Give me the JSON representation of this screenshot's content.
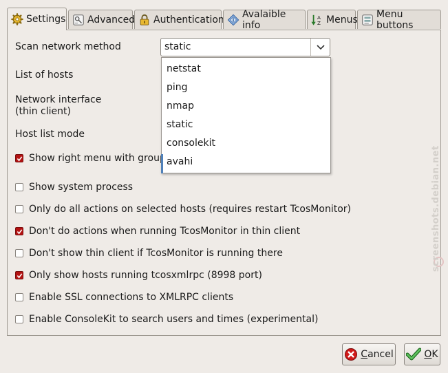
{
  "tabs": [
    {
      "label": "Settings",
      "icon": "gear-icon"
    },
    {
      "label": "Advanced",
      "icon": "advanced-icon"
    },
    {
      "label": "Authentication",
      "icon": "lock-icon"
    },
    {
      "label": "Avalaible info",
      "icon": "info-diamond-icon"
    },
    {
      "label": "Menus",
      "icon": "sort-icon"
    },
    {
      "label": "Menu buttons",
      "icon": "menu-buttons-icon"
    }
  ],
  "form": {
    "scan_method_label": "Scan network method",
    "scan_method_value": "static",
    "hosts_label": "List of hosts",
    "interface_label_1": "Network interface",
    "interface_label_2": "(thin client)",
    "host_mode_label": "Host list mode"
  },
  "dropdown_options": [
    "netstat",
    "ping",
    "nmap",
    "static",
    "consolekit",
    "avahi"
  ],
  "checkboxes": [
    {
      "label": "Show right menu with groups",
      "checked": true
    },
    {
      "label": "Show system process",
      "checked": false
    },
    {
      "label": "Only do all actions on selected hosts (requires restart TcosMonitor)",
      "checked": false
    },
    {
      "label": "Don't do actions when running TcosMonitor in thin client",
      "checked": true
    },
    {
      "label": "Don't show thin client if TcosMonitor is running there",
      "checked": false
    },
    {
      "label": "Only show hosts running tcosxmlrpc (8998 port)",
      "checked": true
    },
    {
      "label": "Enable SSL connections to XMLRPC clients",
      "checked": false
    },
    {
      "label": "Enable ConsoleKit to search users and times (experimental)",
      "checked": false
    }
  ],
  "buttons": {
    "cancel_accel": "C",
    "cancel_rest": "ancel",
    "ok_accel": "O",
    "ok_rest": "K"
  },
  "watermark": "screenshots.debian.net",
  "colors": {
    "check_on": "#b31212",
    "ok_green": "#3aa33a",
    "cancel_red": "#d01a1a"
  }
}
